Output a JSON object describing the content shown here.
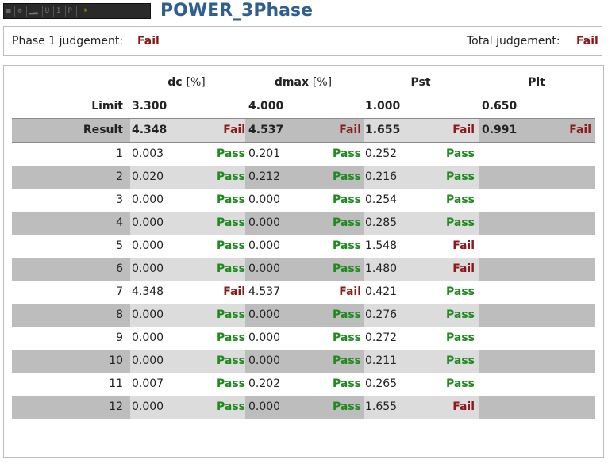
{
  "toolbar": {
    "icons": [
      "grid-icon",
      "gear-icon",
      "wave-icon",
      "u-rms-icon",
      "i-rms-icon",
      "p-icon",
      "light-bulb-icon"
    ],
    "labels": [
      "▦",
      "⚙",
      "▁▂",
      "U",
      "I",
      "P",
      "☀"
    ]
  },
  "app": {
    "title": "POWER_3Phase"
  },
  "judgement": {
    "phase_label": "Phase 1 judgement:",
    "phase_value": "Fail",
    "total_label": "Total judgement:",
    "total_value": "Fail"
  },
  "table": {
    "columns": [
      {
        "name": "dc",
        "unit": "[%]"
      },
      {
        "name": "dmax",
        "unit": "[%]"
      },
      {
        "name": "Pst",
        "unit": ""
      },
      {
        "name": "Plt",
        "unit": ""
      }
    ],
    "limit": {
      "label": "Limit",
      "values": [
        "3.300",
        "4.000",
        "1.000",
        "0.650"
      ]
    },
    "result": {
      "label": "Result",
      "values": [
        "4.348",
        "4.537",
        "1.655",
        "0.991"
      ],
      "status": [
        "Fail",
        "Fail",
        "Fail",
        "Fail"
      ]
    },
    "rows": [
      {
        "idx": "1",
        "dc": "0.003",
        "dc_s": "Pass",
        "dmax": "0.201",
        "dmax_s": "Pass",
        "pst": "0.252",
        "pst_s": "Pass"
      },
      {
        "idx": "2",
        "dc": "0.020",
        "dc_s": "Pass",
        "dmax": "0.212",
        "dmax_s": "Pass",
        "pst": "0.216",
        "pst_s": "Pass"
      },
      {
        "idx": "3",
        "dc": "0.000",
        "dc_s": "Pass",
        "dmax": "0.000",
        "dmax_s": "Pass",
        "pst": "0.254",
        "pst_s": "Pass"
      },
      {
        "idx": "4",
        "dc": "0.000",
        "dc_s": "Pass",
        "dmax": "0.000",
        "dmax_s": "Pass",
        "pst": "0.285",
        "pst_s": "Pass"
      },
      {
        "idx": "5",
        "dc": "0.000",
        "dc_s": "Pass",
        "dmax": "0.000",
        "dmax_s": "Pass",
        "pst": "1.548",
        "pst_s": "Fail"
      },
      {
        "idx": "6",
        "dc": "0.000",
        "dc_s": "Pass",
        "dmax": "0.000",
        "dmax_s": "Pass",
        "pst": "1.480",
        "pst_s": "Fail"
      },
      {
        "idx": "7",
        "dc": "4.348",
        "dc_s": "Fail",
        "dmax": "4.537",
        "dmax_s": "Fail",
        "pst": "0.421",
        "pst_s": "Pass"
      },
      {
        "idx": "8",
        "dc": "0.000",
        "dc_s": "Pass",
        "dmax": "0.000",
        "dmax_s": "Pass",
        "pst": "0.276",
        "pst_s": "Pass"
      },
      {
        "idx": "9",
        "dc": "0.000",
        "dc_s": "Pass",
        "dmax": "0.000",
        "dmax_s": "Pass",
        "pst": "0.272",
        "pst_s": "Pass"
      },
      {
        "idx": "10",
        "dc": "0.000",
        "dc_s": "Pass",
        "dmax": "0.000",
        "dmax_s": "Pass",
        "pst": "0.211",
        "pst_s": "Pass"
      },
      {
        "idx": "11",
        "dc": "0.007",
        "dc_s": "Pass",
        "dmax": "0.202",
        "dmax_s": "Pass",
        "pst": "0.265",
        "pst_s": "Pass"
      },
      {
        "idx": "12",
        "dc": "0.000",
        "dc_s": "Pass",
        "dmax": "0.000",
        "dmax_s": "Pass",
        "pst": "1.655",
        "pst_s": "Fail"
      }
    ]
  },
  "colors": {
    "title": "#2f5f8f",
    "fail": "#8b1a1a",
    "pass": "#1e8a1e",
    "row_grey": "#bdbdbd",
    "row_light": "#dcdcdc"
  }
}
